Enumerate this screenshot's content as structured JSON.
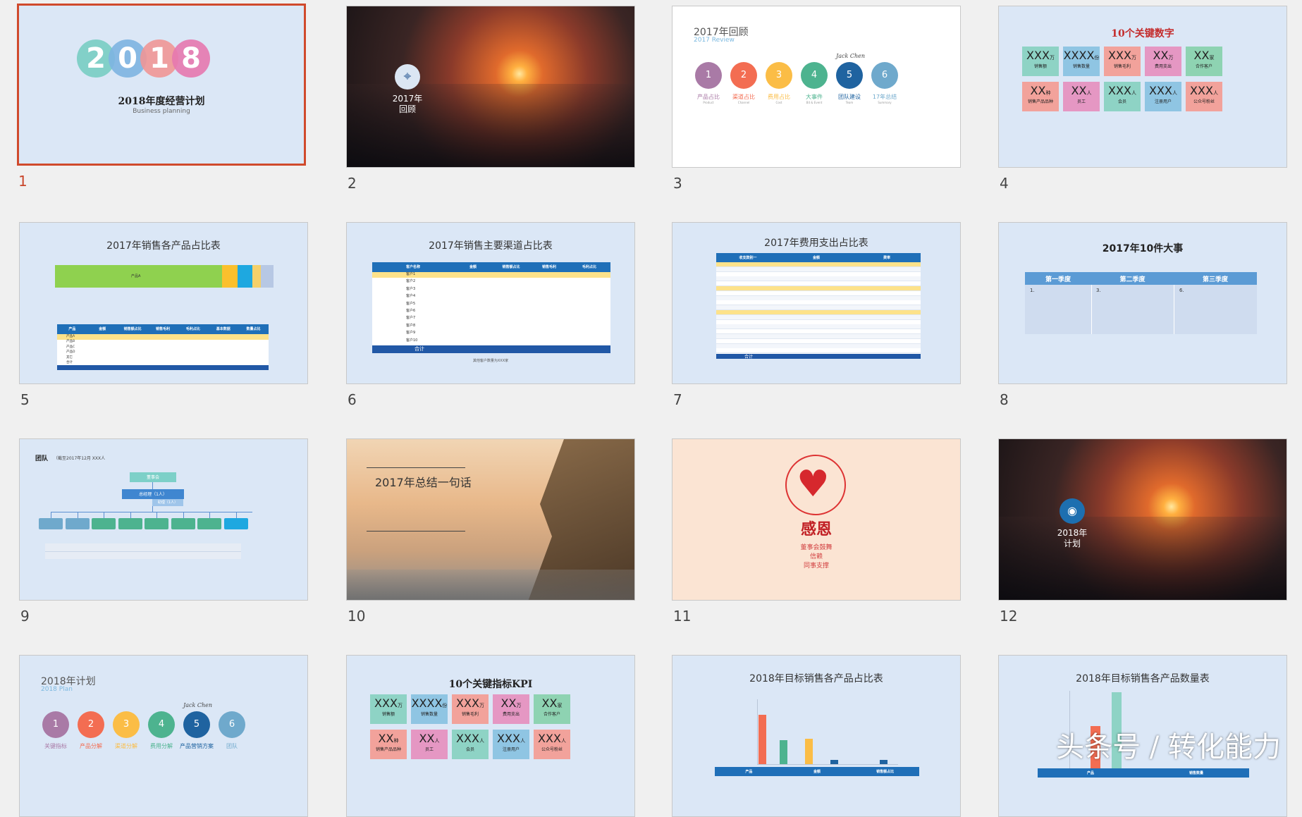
{
  "slides": [
    {
      "number": "1",
      "year_digits": [
        "2",
        "0",
        "1",
        "8"
      ],
      "title": "2018年度经营计划",
      "subtitle": "Business planning"
    },
    {
      "number": "2",
      "label_line1": "2017年",
      "label_line2": "回顾"
    },
    {
      "number": "3",
      "title": "2017年回顾",
      "subtitle": "2017 Review",
      "signature": "Jack Chen",
      "items": [
        {
          "n": "1",
          "label": "产品占比",
          "sub": "Product",
          "color": "#a97aa6"
        },
        {
          "n": "2",
          "label": "渠道占比",
          "sub": "Channel",
          "color": "#f36d52"
        },
        {
          "n": "3",
          "label": "费用占比",
          "sub": "Cost",
          "color": "#fbbd46"
        },
        {
          "n": "4",
          "label": "大事件",
          "sub": "Bit & Event",
          "color": "#4db38f"
        },
        {
          "n": "5",
          "label": "团队建设",
          "sub": "Team",
          "color": "#1f63a0"
        },
        {
          "n": "6",
          "label": "17年总结",
          "sub": "Summary",
          "color": "#6fa9cc"
        }
      ]
    },
    {
      "number": "4",
      "title": "10个关键数字",
      "tiles": [
        {
          "v": "XXX",
          "u": "万",
          "c": "销售额",
          "bg": "#8ed3c5"
        },
        {
          "v": "XXXX",
          "u": "份",
          "c": "销售数量",
          "bg": "#8fc5e3"
        },
        {
          "v": "XXX",
          "u": "万",
          "c": "销售毛利",
          "bg": "#f2a29b"
        },
        {
          "v": "XX",
          "u": "万",
          "c": "费用支出",
          "bg": "#e597c3"
        },
        {
          "v": "XX",
          "u": "家",
          "c": "合作客户",
          "bg": "#8ed3b2"
        },
        {
          "v": "XX",
          "u": "种",
          "c": "销售产品品种",
          "bg": "#f2a29b"
        },
        {
          "v": "XX",
          "u": "人",
          "c": "员工",
          "bg": "#e597c3"
        },
        {
          "v": "XXX",
          "u": "人",
          "c": "会员",
          "bg": "#8ed3c5"
        },
        {
          "v": "XXX",
          "u": "人",
          "c": "注册用户",
          "bg": "#8fc5e3"
        },
        {
          "v": "XXX",
          "u": "人",
          "c": "公众号粉丝",
          "bg": "#f2a29b"
        }
      ]
    },
    {
      "number": "5",
      "title": "2017年销售各产品占比表",
      "bar_label": "产品A",
      "headers": [
        "产品",
        "金额",
        "销售额占比",
        "销售毛利",
        "毛利占比",
        "基本数据",
        "数量占比"
      ],
      "rows": [
        "产品A",
        "产品B",
        "产品C",
        "产品D",
        "其它",
        "合计"
      ]
    },
    {
      "number": "6",
      "title": "2017年销售主要渠道占比表",
      "headers": [
        "客户名称",
        "金额",
        "销售额占比",
        "销售毛利",
        "毛利占比"
      ],
      "rows": [
        "客户1",
        "客户2",
        "客户3",
        "客户4",
        "客户5",
        "客户6",
        "客户7",
        "客户8",
        "客户9",
        "客户10"
      ],
      "total": "合计",
      "note": "其他客户数量为XXX家"
    },
    {
      "number": "7",
      "title": "2017年费用支出占比表",
      "headers": [
        "收支款别一",
        "金额",
        "费率"
      ],
      "total": "合计"
    },
    {
      "number": "8",
      "title": "2017年10件大事",
      "headers": [
        "第一季度",
        "第二季度",
        "第三季度"
      ],
      "cells": [
        "1.",
        "3.",
        "6."
      ]
    },
    {
      "number": "9",
      "title": "团队",
      "caption": "（截至2017年12月 XXX人",
      "board": "董事会",
      "gm": "总经理（1人）",
      "assistant": "助理（1人）"
    },
    {
      "number": "10",
      "title": "2017年总结一句话"
    },
    {
      "number": "11",
      "title": "感恩",
      "lines": [
        "董事会鼓舞",
        "信赖",
        "同事支撑"
      ]
    },
    {
      "number": "12",
      "label_line1": "2018年",
      "label_line2": "计划"
    },
    {
      "number": "13",
      "title": "2018年计划",
      "subtitle": "2018 Plan",
      "signature": "Jack Chen",
      "items": [
        {
          "n": "1",
          "label": "关键指标",
          "color": "#a97aa6"
        },
        {
          "n": "2",
          "label": "产品分解",
          "color": "#f36d52"
        },
        {
          "n": "3",
          "label": "渠道分解",
          "color": "#fbbd46"
        },
        {
          "n": "4",
          "label": "费用分解",
          "color": "#4db38f"
        },
        {
          "n": "5",
          "label": "产品营销方案",
          "color": "#1f63a0"
        },
        {
          "n": "6",
          "label": "团队",
          "color": "#6fa9cc"
        }
      ]
    },
    {
      "number": "14",
      "title": "10个关键指标KPI"
    },
    {
      "number": "15",
      "title": "2018年目标销售各产品占比表",
      "headers": [
        "产品",
        "金额",
        "销售额占比"
      ]
    },
    {
      "number": "16",
      "title": "2018年目标销售各产品数量表",
      "headers": [
        "产品",
        "销售数量"
      ]
    }
  ],
  "watermark": "头条号 / 转化能力",
  "colors": {
    "selected_border": "#d04a2c",
    "slide_bg": "#dbe7f6",
    "table_header": "#1f6fb8"
  }
}
